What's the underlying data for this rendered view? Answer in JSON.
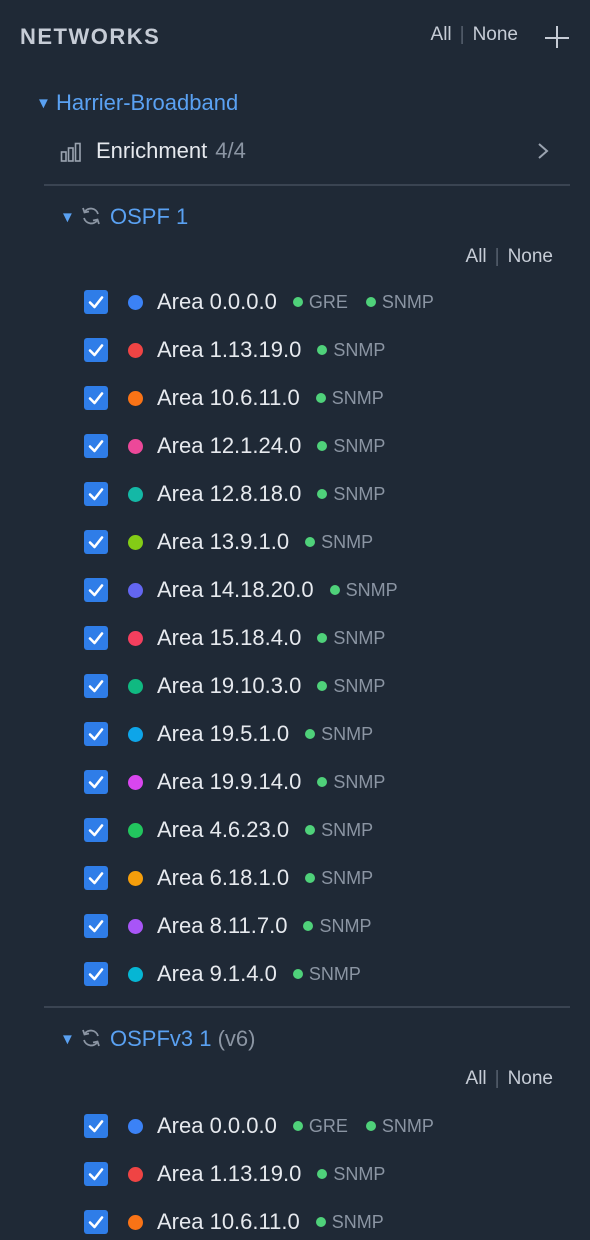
{
  "header": {
    "title": "NETWORKS",
    "all": "All",
    "sep": "|",
    "none": "None"
  },
  "network": {
    "name": "Harrier-Broadband",
    "enrichment_label": "Enrichment",
    "enrichment_count": "4/4"
  },
  "groups": [
    {
      "name": "OSPF 1",
      "sub": "",
      "all": "All",
      "sep": "|",
      "none": "None",
      "rows": [
        {
          "label": "Area 0.0.0.0",
          "color": "#3b82f6",
          "tags": [
            "GRE",
            "SNMP"
          ]
        },
        {
          "label": "Area 1.13.19.0",
          "color": "#ef4444",
          "tags": [
            "SNMP"
          ]
        },
        {
          "label": "Area 10.6.11.0",
          "color": "#f97316",
          "tags": [
            "SNMP"
          ]
        },
        {
          "label": "Area 12.1.24.0",
          "color": "#ec4899",
          "tags": [
            "SNMP"
          ]
        },
        {
          "label": "Area 12.8.18.0",
          "color": "#14b8a6",
          "tags": [
            "SNMP"
          ]
        },
        {
          "label": "Area 13.9.1.0",
          "color": "#84cc16",
          "tags": [
            "SNMP"
          ]
        },
        {
          "label": "Area 14.18.20.0",
          "color": "#6366f1",
          "tags": [
            "SNMP"
          ]
        },
        {
          "label": "Area 15.18.4.0",
          "color": "#f43f5e",
          "tags": [
            "SNMP"
          ]
        },
        {
          "label": "Area 19.10.3.0",
          "color": "#10b981",
          "tags": [
            "SNMP"
          ]
        },
        {
          "label": "Area 19.5.1.0",
          "color": "#0ea5e9",
          "tags": [
            "SNMP"
          ]
        },
        {
          "label": "Area 19.9.14.0",
          "color": "#d946ef",
          "tags": [
            "SNMP"
          ]
        },
        {
          "label": "Area 4.6.23.0",
          "color": "#22c55e",
          "tags": [
            "SNMP"
          ]
        },
        {
          "label": "Area 6.18.1.0",
          "color": "#f59e0b",
          "tags": [
            "SNMP"
          ]
        },
        {
          "label": "Area 8.11.7.0",
          "color": "#a855f7",
          "tags": [
            "SNMP"
          ]
        },
        {
          "label": "Area 9.1.4.0",
          "color": "#06b6d4",
          "tags": [
            "SNMP"
          ]
        }
      ]
    },
    {
      "name": "OSPFv3 1",
      "sub": "(v6)",
      "all": "All",
      "sep": "|",
      "none": "None",
      "rows": [
        {
          "label": "Area 0.0.0.0",
          "color": "#3b82f6",
          "tags": [
            "GRE",
            "SNMP"
          ]
        },
        {
          "label": "Area 1.13.19.0",
          "color": "#ef4444",
          "tags": [
            "SNMP"
          ]
        },
        {
          "label": "Area 10.6.11.0",
          "color": "#f97316",
          "tags": [
            "SNMP"
          ]
        }
      ]
    }
  ]
}
